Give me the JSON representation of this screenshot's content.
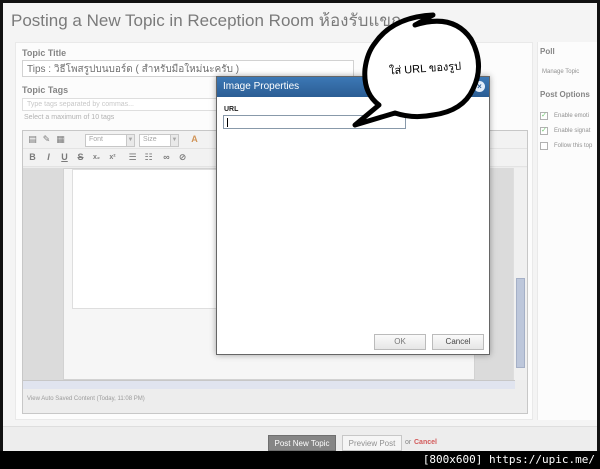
{
  "page": {
    "title": "Posting a New Topic in Reception Room ห้องรับแขก"
  },
  "form": {
    "topic_title_label": "Topic Title",
    "topic_title_value": "Tips : วิธีโพสรูปบนบอร์ด ( สำหรับมือใหม่นะครับ )",
    "topic_tags_label": "Topic Tags",
    "topic_tags_placeholder": "Type tags separated by commas...",
    "tags_hint": "Select a maximum of 10 tags"
  },
  "editor": {
    "font_select": "Font",
    "size_select": "Size",
    "autosave_text": "View Auto Saved Content (Today, 11:08 PM)",
    "toolbar_icons": [
      "source-icon",
      "eraser-icon",
      "image-icon",
      "bold-icon",
      "italic-icon",
      "underline-icon",
      "strikethrough-icon",
      "subscript-icon",
      "superscript-icon",
      "bullet-list-icon",
      "numbered-list-icon",
      "link-icon",
      "text-color-icon"
    ],
    "bold_glyph": "B",
    "italic_glyph": "I",
    "underline_glyph": "U",
    "strike_glyph": "S",
    "sub_glyph": "x₂",
    "sup_glyph": "x²"
  },
  "sidebar": {
    "poll_heading": "Poll",
    "manage_topic": "Manage Topic",
    "post_options_heading": "Post Options",
    "option_emoticons": "Enable emoti",
    "option_signature": "Enable signat",
    "option_follow": "Follow this top"
  },
  "actions": {
    "post_button": "Post New Topic",
    "preview_button": "Preview Post",
    "or_text": "or",
    "cancel_link": "Cancel"
  },
  "dialog": {
    "title": "Image Properties",
    "close_glyph": "×",
    "url_label": "URL",
    "url_value": "",
    "ok_button": "OK",
    "cancel_button": "Cancel"
  },
  "annotation": {
    "callout_text": "ใส่ URL ของรูป"
  },
  "watermark": {
    "text": "[800x600] https://upic.me/"
  },
  "colors": {
    "dialog_header": "#3c78b5",
    "post_button": "#444444",
    "cancel_link": "#bb0000"
  }
}
